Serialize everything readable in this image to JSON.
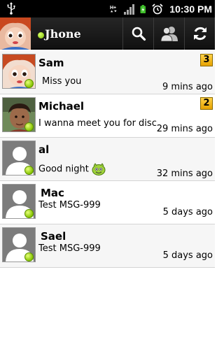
{
  "status_bar": {
    "time": "10:30 PM",
    "network_label": "H+"
  },
  "header": {
    "user_name": "Jhone",
    "online_color": "#7cc000"
  },
  "conversations": [
    {
      "name": "Sam",
      "message": "Miss you",
      "time": "9 mins ago",
      "unread": "3",
      "avatar": "doll-avatar"
    },
    {
      "name": "Michael",
      "message": "I wanna meet you for discus",
      "time": "29 mins ago",
      "unread": "2",
      "avatar": "boy-photo-avatar"
    },
    {
      "name": "al",
      "message": "Good night",
      "time": "32 mins ago",
      "unread": "",
      "avatar": "default-avatar",
      "emoji": "smiley-emoji"
    },
    {
      "name": "Mac",
      "message": "Test MSG-999",
      "time": "5 days ago",
      "unread": "",
      "avatar": "default-avatar"
    },
    {
      "name": "Sael",
      "message": "Test MSG-999",
      "time": "5 days ago",
      "unread": "",
      "avatar": "default-avatar"
    }
  ]
}
